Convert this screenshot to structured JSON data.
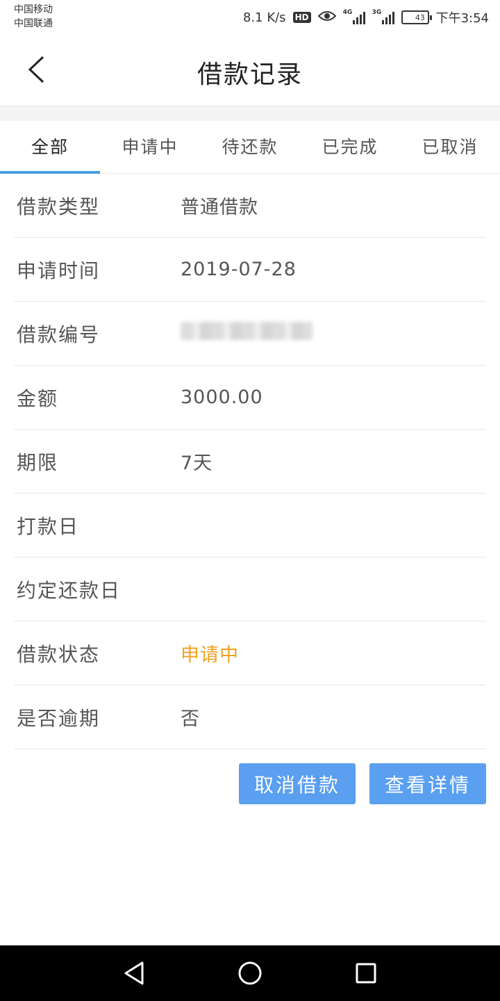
{
  "status_bar": {
    "carrier1": "中国移动",
    "carrier2": "中国联通",
    "speed": "8.1 K/s",
    "hd": "HD",
    "net1": "4G",
    "net2": "3G",
    "battery": "43",
    "battery_level": 0.43,
    "time": "下午3:54"
  },
  "header": {
    "title": "借款记录"
  },
  "tabs": [
    {
      "label": "全部",
      "active": true
    },
    {
      "label": "申请中",
      "active": false
    },
    {
      "label": "待还款",
      "active": false
    },
    {
      "label": "已完成",
      "active": false
    },
    {
      "label": "已取消",
      "active": false
    }
  ],
  "record": {
    "rows": [
      {
        "label": "借款类型",
        "value": "普通借款"
      },
      {
        "label": "申请时间",
        "value": "2019-07-28"
      },
      {
        "label": "借款编号",
        "value": ""
      },
      {
        "label": "金额",
        "value": "3000.00"
      },
      {
        "label": "期限",
        "value": "7天"
      },
      {
        "label": "打款日",
        "value": ""
      },
      {
        "label": "约定还款日",
        "value": ""
      },
      {
        "label": "借款状态",
        "value": "申请中"
      },
      {
        "label": "是否逾期",
        "value": "否"
      }
    ]
  },
  "actions": {
    "cancel_label": "取消借款",
    "detail_label": "查看详情"
  },
  "colors": {
    "accent": "#4a9de0",
    "button": "#5a9ff0",
    "status_pending": "#f0a020"
  },
  "icons": {
    "back": "chevron-left-icon",
    "eye": "eye-icon",
    "nav_back": "triangle-back-icon",
    "nav_home": "circle-home-icon",
    "nav_recent": "square-recent-icon"
  }
}
